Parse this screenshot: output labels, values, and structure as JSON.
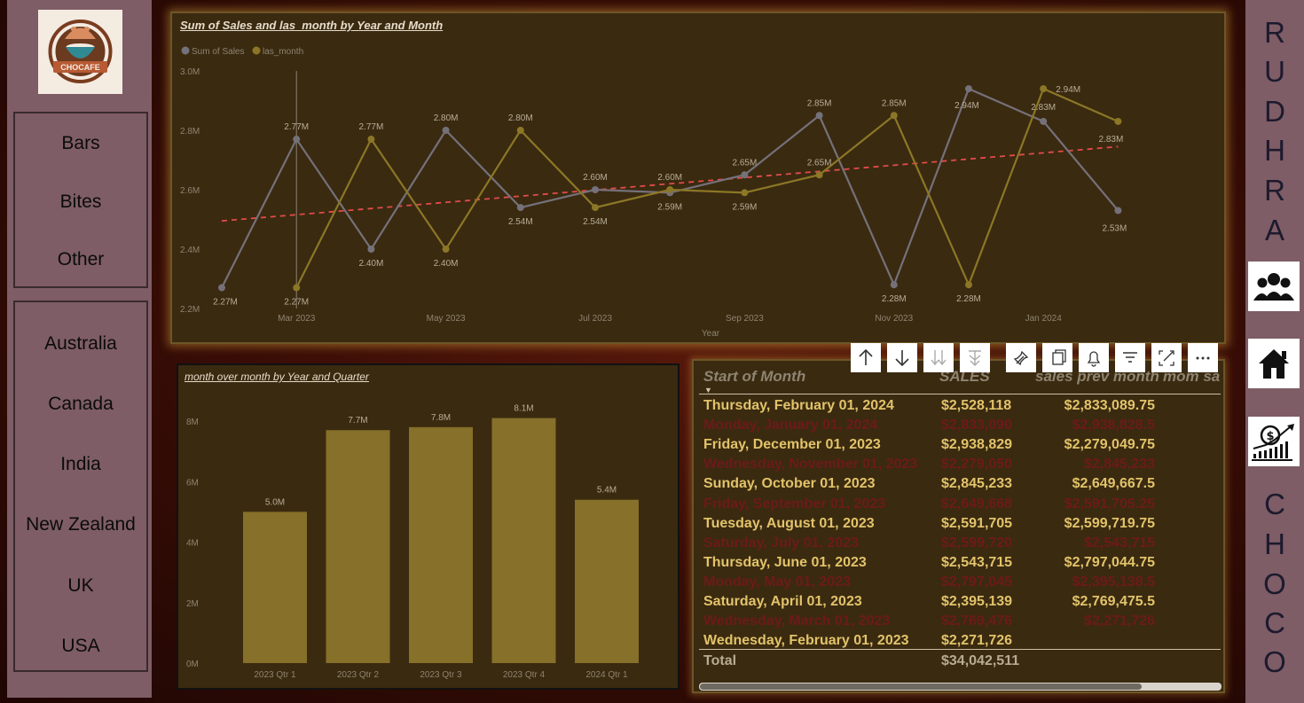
{
  "colors": {
    "sales": "#75717a",
    "last_month": "#8b7726",
    "trend": "#e24b4b",
    "bar": "#86702a",
    "row_odd": "#e2c36a",
    "row_even": "#6d1a1a"
  },
  "logo": {
    "text": "CHOCAFE",
    "sub": "Est."
  },
  "categories": [
    "Bars",
    "Bites",
    "Other"
  ],
  "countries": [
    "Australia",
    "Canada",
    "India",
    "New Zealand",
    "UK",
    "USA"
  ],
  "brand": {
    "top": [
      "R",
      "U",
      "D",
      "H",
      "R",
      "A"
    ],
    "bottom": [
      "C",
      "H",
      "O",
      "C",
      "O"
    ]
  },
  "nav": [
    {
      "icon": "team-icon"
    },
    {
      "icon": "home-icon"
    },
    {
      "icon": "dollar-growth-icon"
    }
  ],
  "line_chart": {
    "title": "Sum of Sales and las_month by Year and Month",
    "legend": [
      "Sum of Sales",
      "las_month"
    ],
    "xlabel": "Year",
    "x_ticks": [
      "Mar 2023",
      "May 2023",
      "Jul 2023",
      "Sep 2023",
      "Nov 2023",
      "Jan 2024"
    ],
    "y_ticks": [
      "2.2M",
      "2.4M",
      "2.6M",
      "2.8M",
      "3.0M"
    ]
  },
  "bar_chart": {
    "title": "month over month by Year and Quarter",
    "y_ticks": [
      "0M",
      "2M",
      "4M",
      "6M",
      "8M"
    ]
  },
  "table": {
    "headers": [
      "Start of Month",
      "SALES",
      "sales prev month",
      "mom sa"
    ],
    "rows": [
      [
        "Thursday, February 01, 2024",
        "$2,528,118",
        "$2,833,089.75"
      ],
      [
        "Monday, January 01, 2024",
        "$2,833,090",
        "$2,938,828.5"
      ],
      [
        "Friday, December 01, 2023",
        "$2,938,829",
        "$2,279,049.75"
      ],
      [
        "Wednesday, November 01, 2023",
        "$2,279,050",
        "$2,845,233"
      ],
      [
        "Sunday, October 01, 2023",
        "$2,845,233",
        "$2,649,667.5"
      ],
      [
        "Friday, September 01, 2023",
        "$2,649,668",
        "$2,591,705.25"
      ],
      [
        "Tuesday, August 01, 2023",
        "$2,591,705",
        "$2,599,719.75"
      ],
      [
        "Saturday, July 01, 2023",
        "$2,599,720",
        "$2,543,715"
      ],
      [
        "Thursday, June 01, 2023",
        "$2,543,715",
        "$2,797,044.75"
      ],
      [
        "Monday, May 01, 2023",
        "$2,797,045",
        "$2,395,138.5"
      ],
      [
        "Saturday, April 01, 2023",
        "$2,395,139",
        "$2,769,475.5"
      ],
      [
        "Wednesday, March 01, 2023",
        "$2,769,476",
        "$2,271,726"
      ],
      [
        "Wednesday, February 01, 2023",
        "$2,271,726",
        ""
      ]
    ],
    "total_label": "Total",
    "total_value": "$34,042,511"
  },
  "visual_toolbar": [
    {
      "icon": "arrow-up-icon"
    },
    {
      "icon": "arrow-down-icon"
    },
    {
      "icon": "drill-down-icon"
    },
    {
      "icon": "expand-hierarchy-icon"
    },
    {
      "icon": "pin-icon"
    },
    {
      "icon": "copy-icon"
    },
    {
      "icon": "bell-icon"
    },
    {
      "icon": "filter-icon"
    },
    {
      "icon": "focus-mode-icon"
    },
    {
      "icon": "more-options-icon"
    }
  ],
  "chart_data": [
    {
      "type": "line",
      "title": "Sum of Sales and las_month by Year and Month",
      "xlabel": "Year",
      "ylabel": "",
      "x": [
        "Feb 2023",
        "Mar 2023",
        "Apr 2023",
        "May 2023",
        "Jun 2023",
        "Jul 2023",
        "Aug 2023",
        "Sep 2023",
        "Oct 2023",
        "Nov 2023",
        "Dec 2023",
        "Jan 2024",
        "Feb 2024"
      ],
      "ylim": [
        2.2,
        3.0
      ],
      "series": [
        {
          "name": "Sum of Sales",
          "values": [
            2.27,
            2.77,
            2.4,
            2.8,
            2.54,
            2.6,
            2.59,
            2.65,
            2.85,
            2.28,
            2.94,
            2.83,
            2.53
          ],
          "labels": [
            "2.27M",
            "2.77M",
            "2.40M",
            "2.80M",
            "2.54M",
            "2.60M",
            "2.59M",
            "2.65M",
            "2.85M",
            "2.28M",
            "2.94M",
            "2.83M",
            "2.53M"
          ]
        },
        {
          "name": "las_month",
          "values": [
            null,
            2.27,
            2.77,
            2.4,
            2.8,
            2.54,
            2.6,
            2.59,
            2.65,
            2.85,
            2.28,
            2.94,
            2.83
          ],
          "labels": [
            "",
            "2.27M",
            "2.77M",
            "2.40M",
            "2.80M",
            "2.54M",
            "2.60M",
            "2.59M",
            "2.65M",
            "2.85M",
            "2.28M",
            "2.94M",
            "2.83M"
          ]
        }
      ],
      "trend_line": {
        "from": 2.495,
        "to": 2.745
      },
      "grid": false,
      "legend": "top-left"
    },
    {
      "type": "bar",
      "title": "month over month by Year and Quarter",
      "categories": [
        "2023 Qtr 1",
        "2023 Qtr 2",
        "2023 Qtr 3",
        "2023 Qtr 4",
        "2024 Qtr 1"
      ],
      "values": [
        5.0,
        7.7,
        7.8,
        8.1,
        5.4
      ],
      "labels": [
        "5.0M",
        "7.7M",
        "7.8M",
        "8.1M",
        "5.4M"
      ],
      "ylim": [
        0,
        8.5
      ],
      "grid": false
    }
  ]
}
